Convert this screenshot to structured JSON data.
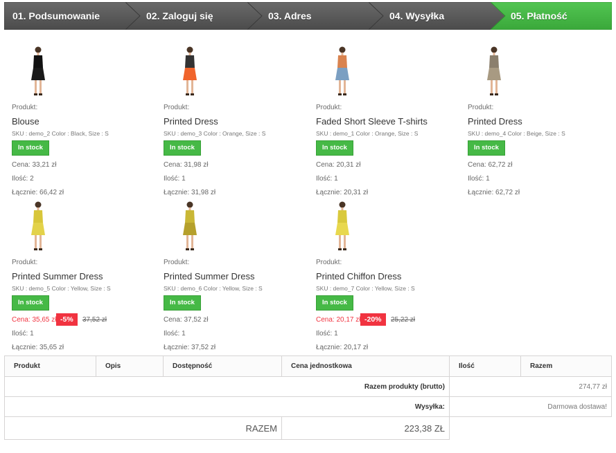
{
  "steps": [
    {
      "label": "01. Podsumowanie",
      "state": "done"
    },
    {
      "label": "02. Zaloguj się",
      "state": "done"
    },
    {
      "label": "03. Adres",
      "state": "done"
    },
    {
      "label": "04. Wysyłka",
      "state": "done"
    },
    {
      "label": "05. Płatność",
      "state": "current"
    }
  ],
  "colors": {
    "step_inactive": "#555555",
    "step_active": "#46b946",
    "in_stock": "#46b946",
    "sale": "#f13340"
  },
  "products": [
    {
      "label": "Produkt:",
      "name": "Blouse",
      "sku": "SKU : demo_2 Color : Black, Size : S",
      "stock": "In stock",
      "price": "Cena: 33,21 zł",
      "qty": "Ilość: 2",
      "total": "Łącznie: 66,42 zł",
      "image_icon": "black-blouse-photo"
    },
    {
      "label": "Produkt:",
      "name": "Printed Dress",
      "sku": "SKU : demo_3 Color : Orange, Size : S",
      "stock": "In stock",
      "price": "Cena: 31,98 zł",
      "qty": "Ilość: 1",
      "total": "Łącznie: 31,98 zł",
      "image_icon": "orange-dress-photo"
    },
    {
      "label": "Produkt:",
      "name": "Faded Short Sleeve T-shirts",
      "sku": "SKU : demo_1 Color : Orange, Size : S",
      "stock": "In stock",
      "price": "Cena: 20,31 zł",
      "qty": "Ilość: 1",
      "total": "Łącznie: 20,31 zł",
      "image_icon": "tshirt-photo"
    },
    {
      "label": "Produkt:",
      "name": "Printed Dress",
      "sku": "SKU : demo_4 Color : Beige, Size : S",
      "stock": "In stock",
      "price": "Cena: 62,72 zł",
      "qty": "Ilość: 1",
      "total": "Łącznie: 62,72 zł",
      "image_icon": "beige-dress-photo"
    },
    {
      "label": "Produkt:",
      "name": "Printed Summer Dress",
      "sku": "SKU : demo_5 Color : Yellow, Size : S",
      "stock": "In stock",
      "price": "Cena: 35,65 zł",
      "discount": "-5%",
      "old_price": "37,52 zł",
      "qty": "Ilość: 1",
      "total": "Łącznie: 35,65 zł",
      "image_icon": "yellow-summer-dress-photo"
    },
    {
      "label": "Produkt:",
      "name": "Printed Summer Dress",
      "sku": "SKU : demo_6 Color : Yellow, Size : S",
      "stock": "In stock",
      "price": "Cena: 37,52 zł",
      "qty": "Ilość: 1",
      "total": "Łącznie: 37,52 zł",
      "image_icon": "yellow-dress-photo"
    },
    {
      "label": "Produkt:",
      "name": "Printed Chiffon Dress",
      "sku": "SKU : demo_7 Color : Yellow, Size : S",
      "stock": "In stock",
      "price": "Cena: 20,17 zł",
      "discount": "-20%",
      "old_price": "25,22 zł",
      "qty": "Ilość: 1",
      "total": "Łącznie: 20,17 zł",
      "image_icon": "chiffon-dress-photo"
    }
  ],
  "table": {
    "headers": [
      "Produkt",
      "Opis",
      "Dostępność",
      "Cena jednostkowa",
      "Ilość",
      "Razem"
    ],
    "subtotal_label": "Razem produkty (brutto)",
    "subtotal_value": "274,77 zł",
    "shipping_label": "Wysyłka:",
    "shipping_value": "Darmowa dostawa!",
    "total_label": "RAZEM",
    "total_value": "223,38 ZŁ"
  }
}
